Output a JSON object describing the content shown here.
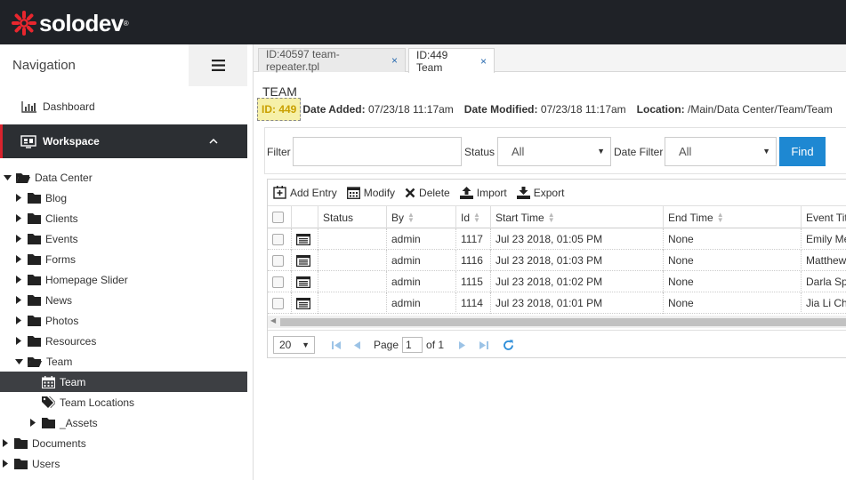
{
  "brand": {
    "name": "solodev",
    "reg": "®",
    "accent": "#e8262e"
  },
  "navigation": {
    "title": "Navigation",
    "dashboard": "Dashboard",
    "workspace": "Workspace",
    "tree": [
      {
        "label": "Data Center",
        "expanded": true
      },
      {
        "label": "Blog"
      },
      {
        "label": "Clients"
      },
      {
        "label": "Events"
      },
      {
        "label": "Forms"
      },
      {
        "label": "Homepage Slider"
      },
      {
        "label": "News"
      },
      {
        "label": "Photos"
      },
      {
        "label": "Resources"
      },
      {
        "label": "Team",
        "expanded": true
      },
      {
        "label": "Team",
        "active": true
      },
      {
        "label": "Team Locations"
      },
      {
        "label": "_Assets"
      },
      {
        "label": "Documents"
      },
      {
        "label": "Users"
      }
    ]
  },
  "tabs": [
    {
      "label": "ID:40597 team-repeater.tpl",
      "close": "×"
    },
    {
      "label": "ID:449 Team",
      "close": "×",
      "active": true
    }
  ],
  "page": {
    "title": "TEAM",
    "id_badge": "ID: 449",
    "date_added_label": "Date Added:",
    "date_added": "07/23/18 11:17am",
    "date_modified_label": "Date Modified:",
    "date_modified": "07/23/18 11:17am",
    "location_label": "Location:",
    "location": "/Main/Data Center/Team/Team"
  },
  "filters": {
    "filter_label": "Filter",
    "filter_value": "",
    "status_label": "Status",
    "status_value": "All",
    "date_filter_label": "Date Filter",
    "date_filter_value": "All",
    "find": "Find"
  },
  "toolbar": {
    "add": "Add Entry",
    "modify": "Modify",
    "delete": "Delete",
    "import": "Import",
    "export": "Export"
  },
  "table": {
    "columns": [
      "Status",
      "By",
      "Id",
      "Start Time",
      "End Time",
      "Event Title"
    ],
    "rows": [
      {
        "by": "admin",
        "id": "1117",
        "start": "Jul 23 2018, 01:05 PM",
        "end": "None",
        "title": "Emily Me"
      },
      {
        "by": "admin",
        "id": "1116",
        "start": "Jul 23 2018, 01:03 PM",
        "end": "None",
        "title": "Matthew"
      },
      {
        "by": "admin",
        "id": "1115",
        "start": "Jul 23 2018, 01:02 PM",
        "end": "None",
        "title": "Darla Spr"
      },
      {
        "by": "admin",
        "id": "1114",
        "start": "Jul 23 2018, 01:01 PM",
        "end": "None",
        "title": "Jia Li Chu"
      }
    ]
  },
  "pager": {
    "page_size": "20",
    "page_label": "Page",
    "page": "1",
    "of_label": "of 1"
  }
}
